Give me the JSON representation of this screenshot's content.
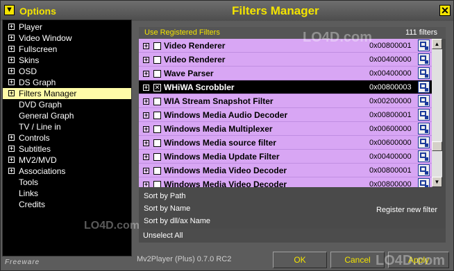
{
  "titlebar": {
    "options_label": "Options",
    "title": "Filters Manager",
    "options_icon": "arrow-down-icon",
    "close_icon": "close-icon"
  },
  "sidebar": {
    "items": [
      {
        "label": "Player",
        "expandable": true
      },
      {
        "label": "Video Window",
        "expandable": true
      },
      {
        "label": "Fullscreen",
        "expandable": true
      },
      {
        "label": "Skins",
        "expandable": true
      },
      {
        "label": "OSD",
        "expandable": true
      },
      {
        "label": "DS Graph",
        "expandable": true
      },
      {
        "label": "Filters Manager",
        "expandable": true,
        "selected": true
      },
      {
        "label": "DVD Graph",
        "expandable": false
      },
      {
        "label": "General Graph",
        "expandable": false
      },
      {
        "label": "TV / Line in",
        "expandable": false
      },
      {
        "label": "Controls",
        "expandable": true
      },
      {
        "label": "Subtitles",
        "expandable": true
      },
      {
        "label": "MV2/MVD",
        "expandable": true
      },
      {
        "label": "Associations",
        "expandable": true
      },
      {
        "label": "Tools",
        "expandable": false
      },
      {
        "label": "Links",
        "expandable": false
      },
      {
        "label": "Credits",
        "expandable": false
      }
    ]
  },
  "panel": {
    "use_registered": "Use Registered Filters",
    "filter_count": "111 filters"
  },
  "filters": [
    {
      "name": "Video Renderer",
      "code": "0x00800001",
      "checked": false,
      "selected": false
    },
    {
      "name": "Video Renderer",
      "code": "0x00400000",
      "checked": false,
      "selected": false
    },
    {
      "name": "Wave Parser",
      "code": "0x00400000",
      "checked": false,
      "selected": false
    },
    {
      "name": "WHiWA Scrobbler",
      "code": "0x00800003",
      "checked": true,
      "selected": true
    },
    {
      "name": "WIA Stream Snapshot Filter",
      "code": "0x00200000",
      "checked": false,
      "selected": false
    },
    {
      "name": "Windows Media Audio Decoder",
      "code": "0x00800001",
      "checked": false,
      "selected": false
    },
    {
      "name": "Windows Media Multiplexer",
      "code": "0x00600000",
      "checked": false,
      "selected": false
    },
    {
      "name": "Windows Media source filter",
      "code": "0x00600000",
      "checked": false,
      "selected": false
    },
    {
      "name": "Windows Media Update Filter",
      "code": "0x00400000",
      "checked": false,
      "selected": false
    },
    {
      "name": "Windows Media Video Decoder",
      "code": "0x00800001",
      "checked": false,
      "selected": false
    },
    {
      "name": "Windows Media Video Decoder",
      "code": "0x00800000",
      "checked": false,
      "selected": false
    }
  ],
  "options": {
    "sort_path": "Sort by Path",
    "sort_name": "Sort by Name",
    "sort_dll": "Sort by dll/ax Name",
    "register": "Register new filter",
    "unselect_all": "Unselect All"
  },
  "footer": {
    "freeware": "Freeware",
    "version": "Mv2Player (Plus) 0.7.0 RC2",
    "ok": "OK",
    "cancel": "Cancel",
    "apply": "Apply"
  },
  "watermark": "LO4D.com"
}
